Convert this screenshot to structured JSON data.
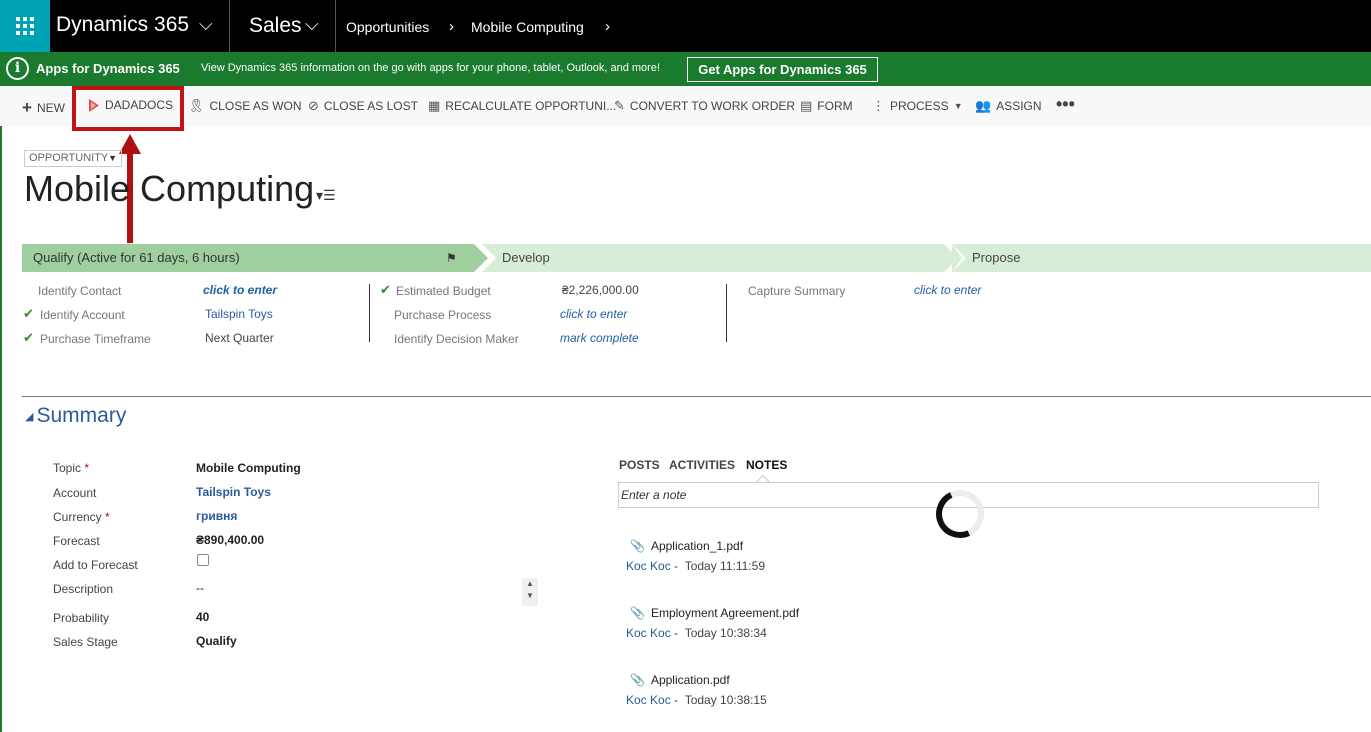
{
  "nav": {
    "brand": "Dynamics 365",
    "app": "Sales",
    "breadcrumb": [
      "Opportunities",
      "Mobile Computing"
    ],
    "colors": {
      "waffle": "#00a3b3",
      "bar": "#000000"
    }
  },
  "banner": {
    "title": "Apps for Dynamics 365",
    "text": "View Dynamics 365 information on the go with apps for your phone, tablet, Outlook, and more!",
    "button": "Get Apps for Dynamics 365",
    "color": "#1a7a2e"
  },
  "commands": {
    "new": "NEW",
    "dadadocs": "DADADOCS",
    "close_won": "CLOSE AS WON",
    "close_lost": "CLOSE AS LOST",
    "recalculate": "RECALCULATE OPPORTUNI...",
    "convert": "CONVERT TO WORK ORDER",
    "form": "FORM",
    "process": "PROCESS",
    "assign": "ASSIGN"
  },
  "record": {
    "entity": "OPPORTUNITY",
    "title": "Mobile Computing"
  },
  "process": {
    "stages": [
      "Qualify (Active for 61 days, 6 hours)",
      "Develop",
      "Propose"
    ],
    "col1": [
      {
        "label": "Identify Contact",
        "value": "click to enter",
        "done": false
      },
      {
        "label": "Identify Account",
        "value": "Tailspin Toys",
        "done": true
      },
      {
        "label": "Purchase Timeframe",
        "value": "Next Quarter",
        "done": true
      }
    ],
    "col2": [
      {
        "label": "Estimated Budget",
        "value": "₴2,226,000.00",
        "done": true
      },
      {
        "label": "Purchase Process",
        "value": "click to enter",
        "done": false
      },
      {
        "label": "Identify Decision Maker",
        "value": "mark complete",
        "done": false
      }
    ],
    "col3": [
      {
        "label": "Capture Summary",
        "value": "click to enter",
        "done": false
      }
    ]
  },
  "summary": {
    "heading": "Summary",
    "fields": {
      "topic": {
        "label": "Topic",
        "value": "Mobile Computing"
      },
      "account": {
        "label": "Account",
        "value": "Tailspin Toys"
      },
      "currency": {
        "label": "Currency",
        "value": "гривня"
      },
      "forecast": {
        "label": "Forecast",
        "value": "₴890,400.00"
      },
      "add_forecast": {
        "label": "Add to Forecast"
      },
      "description": {
        "label": "Description",
        "value": "--"
      },
      "probability": {
        "label": "Probability",
        "value": "40"
      },
      "sales_stage": {
        "label": "Sales Stage",
        "value": "Qualify"
      }
    }
  },
  "notes": {
    "tabs": [
      "POSTS",
      "ACTIVITIES",
      "NOTES"
    ],
    "placeholder": "Enter a note",
    "items": [
      {
        "file": "Application_1.pdf",
        "author": "Koc Koc",
        "time": "Today 11:11:59"
      },
      {
        "file": "Employment Agreement.pdf",
        "author": "Koc Koc",
        "time": "Today 10:38:34"
      },
      {
        "file": "Application.pdf",
        "author": "Koc Koc",
        "time": "Today 10:38:15"
      }
    ]
  }
}
